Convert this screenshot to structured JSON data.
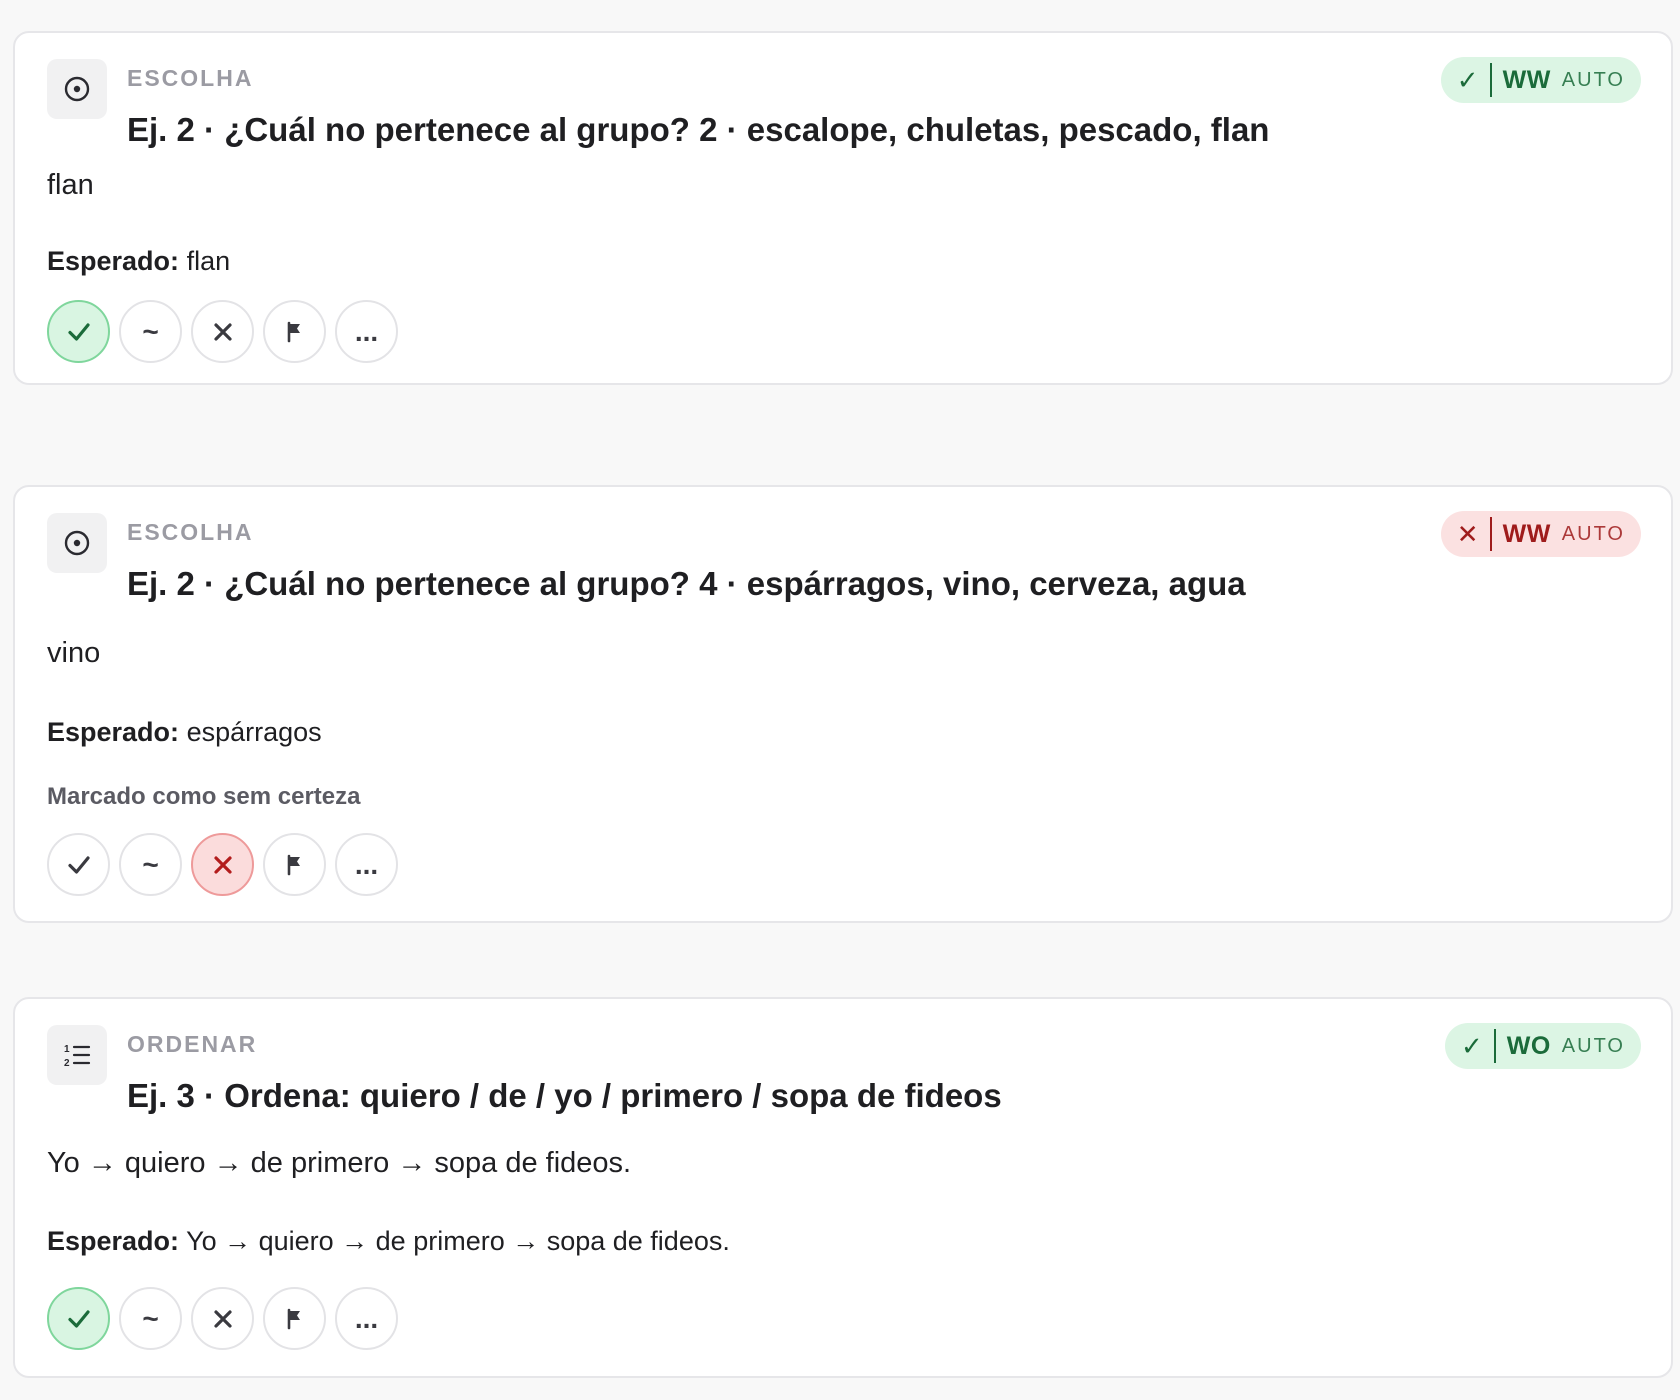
{
  "cards": [
    {
      "type_label": "ESCOLHA",
      "type_icon": "radio-target-icon",
      "title": "Ej. 2 · ¿Cuál no pertenece al grupo? 2 · escalope, chuletas, pescado, flan",
      "answer": "flan",
      "expected_label": "Esperado:",
      "expected_value": "flan",
      "note": "",
      "badge": {
        "status": "correct",
        "mark": "✓",
        "code": "WW",
        "auto": "AUTO"
      },
      "selected_action": "correct"
    },
    {
      "type_label": "ESCOLHA",
      "type_icon": "radio-target-icon",
      "title": "Ej. 2 · ¿Cuál no pertenece al grupo? 4 · espárragos, vino, cerveza, agua",
      "answer": "vino",
      "expected_label": "Esperado:",
      "expected_value": "espárragos",
      "note": "Marcado como sem certeza",
      "badge": {
        "status": "wrong",
        "mark": "✕",
        "code": "WW",
        "auto": "AUTO"
      },
      "selected_action": "wrong"
    },
    {
      "type_label": "ORDENAR",
      "type_icon": "ordered-list-icon",
      "title": "Ej. 3 · Ordena: quiero / de / yo / primero / sopa de fideos",
      "answer": "Yo → quiero → de primero → sopa de fideos.",
      "expected_label": "Esperado:",
      "expected_value": "Yo → quiero → de primero → sopa de fideos.",
      "note": "",
      "badge": {
        "status": "correct",
        "mark": "✓",
        "code": "WO",
        "auto": "AUTO"
      },
      "selected_action": "correct"
    }
  ],
  "actions": {
    "partial": "~",
    "more": "..."
  },
  "colors": {
    "correct_bg": "#dcf5e4",
    "correct_fg": "#1b6b3a",
    "wrong_bg": "#fbe1e1",
    "wrong_fg": "#9f1c1c"
  }
}
